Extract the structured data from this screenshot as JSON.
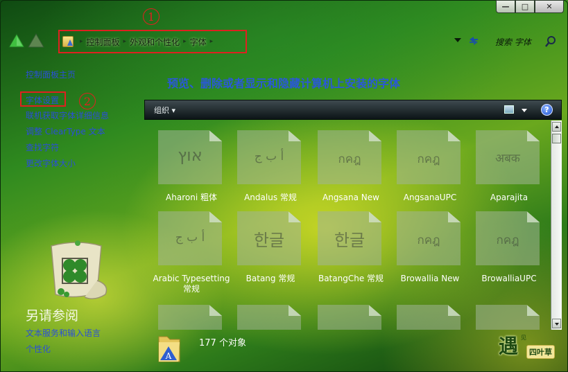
{
  "window": {
    "minimize_label": "—",
    "maximize_label": "□",
    "close_label": "✕"
  },
  "address": {
    "crumbs": [
      "控制面板",
      "外观和个性化",
      "字体"
    ],
    "annotation_1": "1"
  },
  "search": {
    "placeholder": "搜索 字体"
  },
  "sidebar": {
    "home": "控制面板主页",
    "links": [
      "字体设置",
      "联机获取字体详细信息",
      "调整 ClearType 文本",
      "查找字符",
      "更改字体大小"
    ],
    "annotation_2": "2",
    "see_also_title": "另请参阅",
    "see_also_links": [
      "文本服务和输入语言",
      "个性化"
    ]
  },
  "main": {
    "title": "预览、删除或者显示和隐藏计算机上安装的字体",
    "organize_label": "组织 ▾",
    "help_label": "?"
  },
  "fonts": [
    {
      "name": "Aharoni 粗体",
      "sample": "אוץ"
    },
    {
      "name": "Andalus 常规",
      "sample": "أ ب ج"
    },
    {
      "name": "Angsana New",
      "sample": "กคฎ"
    },
    {
      "name": "AngsanaUPC",
      "sample": "กคฎ"
    },
    {
      "name": "Aparajita",
      "sample": "अबक"
    },
    {
      "name": "Arabic Typesetting 常规",
      "sample": "أ ب ج"
    },
    {
      "name": "Batang 常规",
      "sample": "한글"
    },
    {
      "name": "BatangChe 常规",
      "sample": "한글"
    },
    {
      "name": "Browallia New",
      "sample": "กคฎ"
    },
    {
      "name": "BrowalliaUPC",
      "sample": "กคฎ"
    }
  ],
  "status": {
    "count_text": "177 个对象"
  },
  "watermark": {
    "char": "遇",
    "badge": "四叶草",
    "small": "见"
  },
  "colors": {
    "link": "#2a4fd8",
    "annotation": "#e02020",
    "title": "#2a58d8"
  }
}
